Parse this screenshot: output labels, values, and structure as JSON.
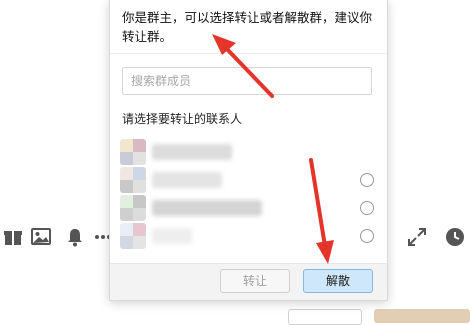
{
  "dialog": {
    "notice": "你是群主，可以选择转让或者解散群，建议你转让群。",
    "search": {
      "placeholder": "搜索群成员",
      "value": ""
    },
    "section_label": "请选择要转让的联系人",
    "members": [
      {
        "avatar_colors": [
          "#f3e6cf",
          "#d9b9c2",
          "#c9ccd6",
          "#e2e2e2"
        ],
        "name_color": "#dcdcdc",
        "name_width": 80,
        "radio": false
      },
      {
        "avatar_colors": [
          "#f0e7e3",
          "#cfd6e6",
          "#c8c8c8",
          "#e0e0e0"
        ],
        "name_color": "#e4e4e4",
        "name_width": 70,
        "radio": true
      },
      {
        "avatar_colors": [
          "#e3efe0",
          "#c7c7c7",
          "#cfcfcf",
          "#dcdcdc"
        ],
        "name_color": "#d4d4d4",
        "name_width": 110,
        "radio": true
      },
      {
        "avatar_colors": [
          "#e9edf5",
          "#e6c6cf",
          "#d3d7e3",
          "#e4e4e4"
        ],
        "name_color": "#eeeeee",
        "name_width": 40,
        "radio": true
      }
    ],
    "buttons": {
      "transfer": "转让",
      "dissolve": "解散"
    }
  },
  "background_toolbar": {
    "icons": [
      "gift-icon",
      "image-icon",
      "bell-icon",
      "more-icon",
      "expand-icon",
      "history-icon"
    ]
  },
  "colors": {
    "annotation_red": "#e5352b",
    "primary_button_bg": "#cfe7fb",
    "primary_button_border": "#7fb7e6"
  }
}
